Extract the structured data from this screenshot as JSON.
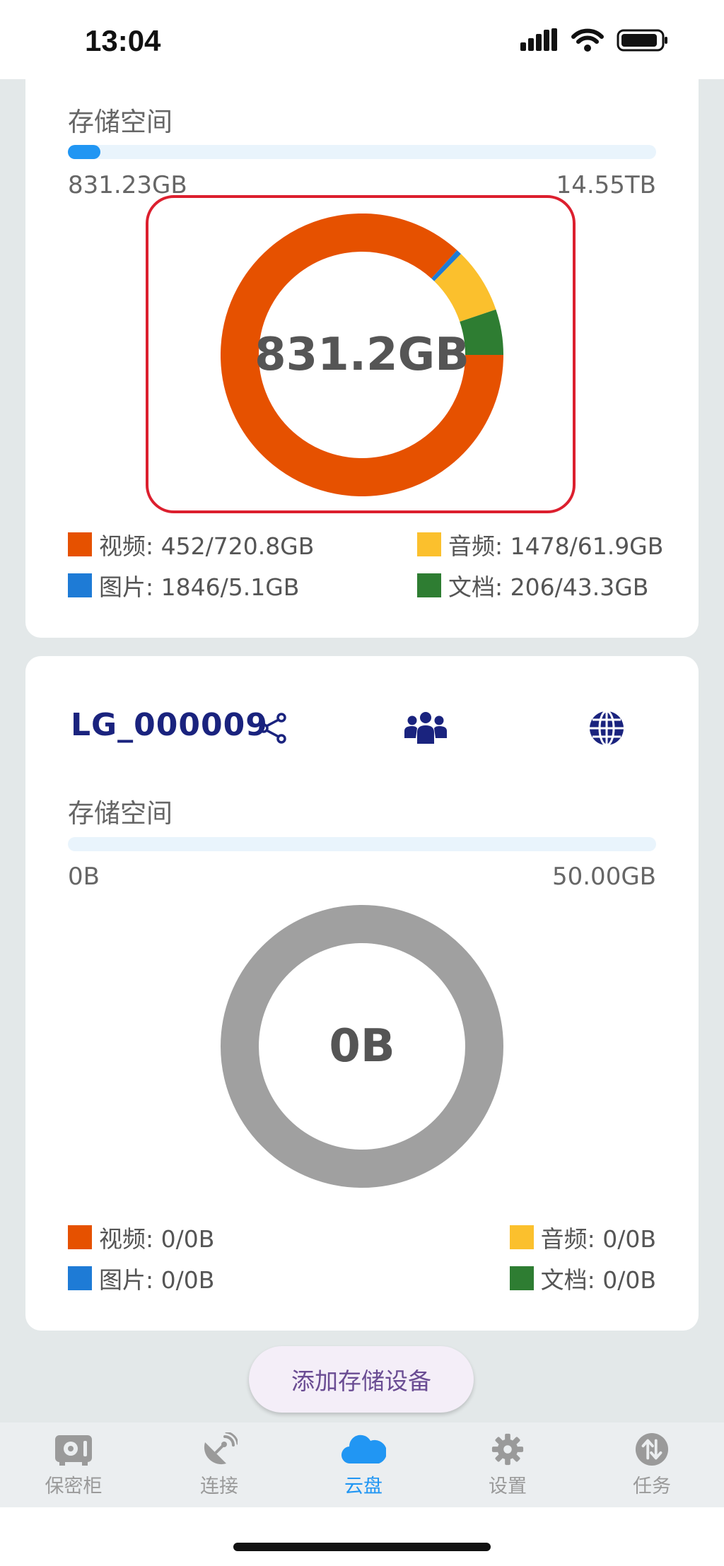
{
  "status_bar": {
    "time": "13:04"
  },
  "card1": {
    "storage_label": "存储空间",
    "used": "831.23GB",
    "total": "14.55TB",
    "used_fraction": 0.055,
    "center_value": "831.2GB",
    "legend": {
      "video": "视频: 452/720.8GB",
      "audio": "音频: 1478/61.9GB",
      "image": "图片: 1846/5.1GB",
      "doc": "文档: 206/43.3GB"
    }
  },
  "card2": {
    "device_name": "LG_000009",
    "storage_label": "存储空间",
    "used": "0B",
    "total": "50.00GB",
    "center_value": "0B",
    "legend": {
      "video": "视频: 0/0B",
      "audio": "音频: 0/0B",
      "image": "图片: 0/0B",
      "doc": "文档: 0/0B"
    }
  },
  "add_button": "添加存储设备",
  "tabs": [
    {
      "label": "保密柜",
      "icon": "safe-icon"
    },
    {
      "label": "连接",
      "icon": "satellite-dish-icon"
    },
    {
      "label": "云盘",
      "icon": "cloud-icon",
      "active": true
    },
    {
      "label": "设置",
      "icon": "gear-icon"
    },
    {
      "label": "任务",
      "icon": "transfer-icon"
    }
  ],
  "colors": {
    "video": "#e65100",
    "audio": "#fbc02d",
    "image": "#1e7bd6",
    "doc": "#2e7d32",
    "empty": "#a0a0a0",
    "accent": "#2196f3"
  },
  "chart_data": [
    {
      "type": "pie",
      "center_label": "831.2GB",
      "categories": [
        "视频",
        "图片",
        "音频",
        "文档"
      ],
      "values": [
        720.8,
        5.1,
        61.9,
        43.3
      ]
    },
    {
      "type": "pie",
      "center_label": "0B",
      "categories": [
        "视频",
        "图片",
        "音频",
        "文档"
      ],
      "values": [
        0,
        0,
        0,
        0
      ]
    }
  ]
}
